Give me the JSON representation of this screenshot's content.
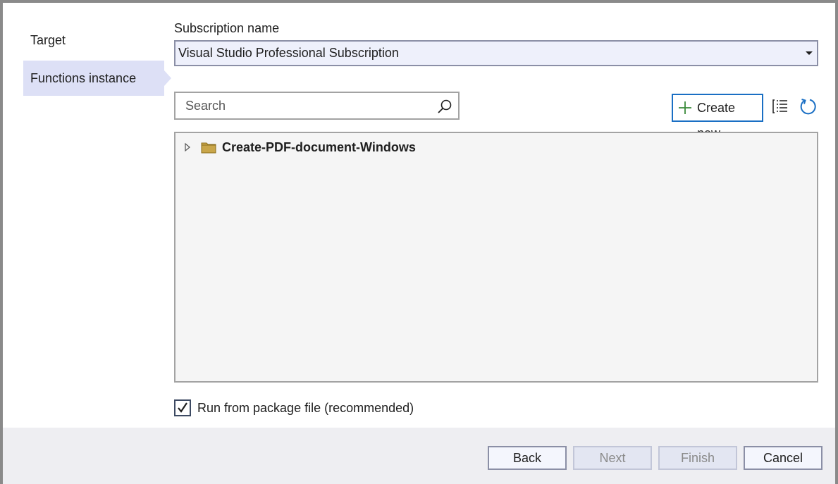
{
  "nav": {
    "items": [
      {
        "label": "Target",
        "selected": false
      },
      {
        "label": "Functions instance",
        "selected": true
      }
    ]
  },
  "subscription": {
    "label": "Subscription name",
    "value": "Visual Studio Professional Subscription"
  },
  "toolbar": {
    "search_placeholder": "Search",
    "create_new_label": "Create new",
    "icons": [
      "search-icon",
      "plus-icon",
      "filter-list-icon",
      "refresh-icon"
    ]
  },
  "tree": {
    "items": [
      {
        "label": "Create-PDF-document-Windows",
        "icon": "folder-icon",
        "expanded": false
      }
    ]
  },
  "options": {
    "run_from_package_label": "Run from package file (recommended)",
    "run_from_package_checked": true
  },
  "footer": {
    "back_label": "Back",
    "next_label": "Next",
    "finish_label": "Finish",
    "cancel_label": "Cancel"
  },
  "colors": {
    "accent": "#1a6fc4",
    "selected_nav": "#dde0f6",
    "folder": "#c9a64a",
    "plus_green": "#3a8a3a"
  }
}
